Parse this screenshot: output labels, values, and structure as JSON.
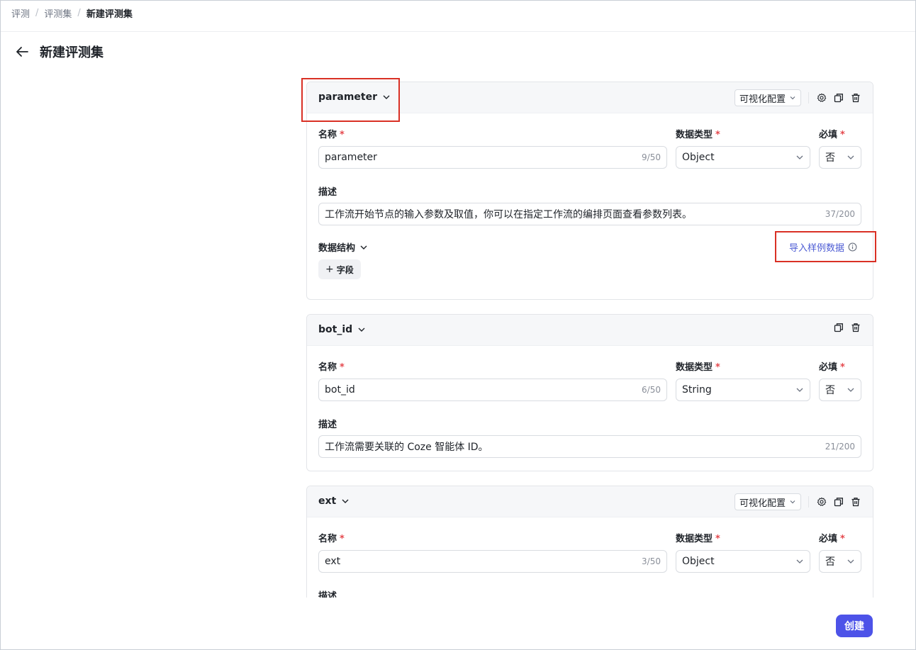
{
  "breadcrumb": [
    "评测",
    "评测集",
    "新建评测集"
  ],
  "page_title": "新建评测集",
  "labels": {
    "name": "名称",
    "data_type": "数据类型",
    "required": "必填",
    "description": "描述",
    "data_structure": "数据结构",
    "import_sample": "导入样例数据",
    "add_field": "字段",
    "visual_config": "可视化配置",
    "required_mark": "*"
  },
  "fields": [
    {
      "title": "parameter",
      "name_value": "parameter",
      "name_count": "9/50",
      "data_type": "Object",
      "required": "否",
      "description": "工作流开始节点的输入参数及取值，你可以在指定工作流的编排页面查看参数列表。",
      "description_count": "37/200"
    },
    {
      "title": "bot_id",
      "name_value": "bot_id",
      "name_count": "6/50",
      "data_type": "String",
      "required": "否",
      "description": "工作流需要关联的 Coze 智能体 ID。",
      "description_count": "21/200"
    },
    {
      "title": "ext",
      "name_value": "ext",
      "name_count": "3/50",
      "data_type": "Object",
      "required": "否"
    }
  ],
  "create_button": "创建",
  "colors": {
    "primary": "#4d53e8",
    "link": "#4c5bd4",
    "required": "#e5484d",
    "highlight": "#d93025"
  }
}
